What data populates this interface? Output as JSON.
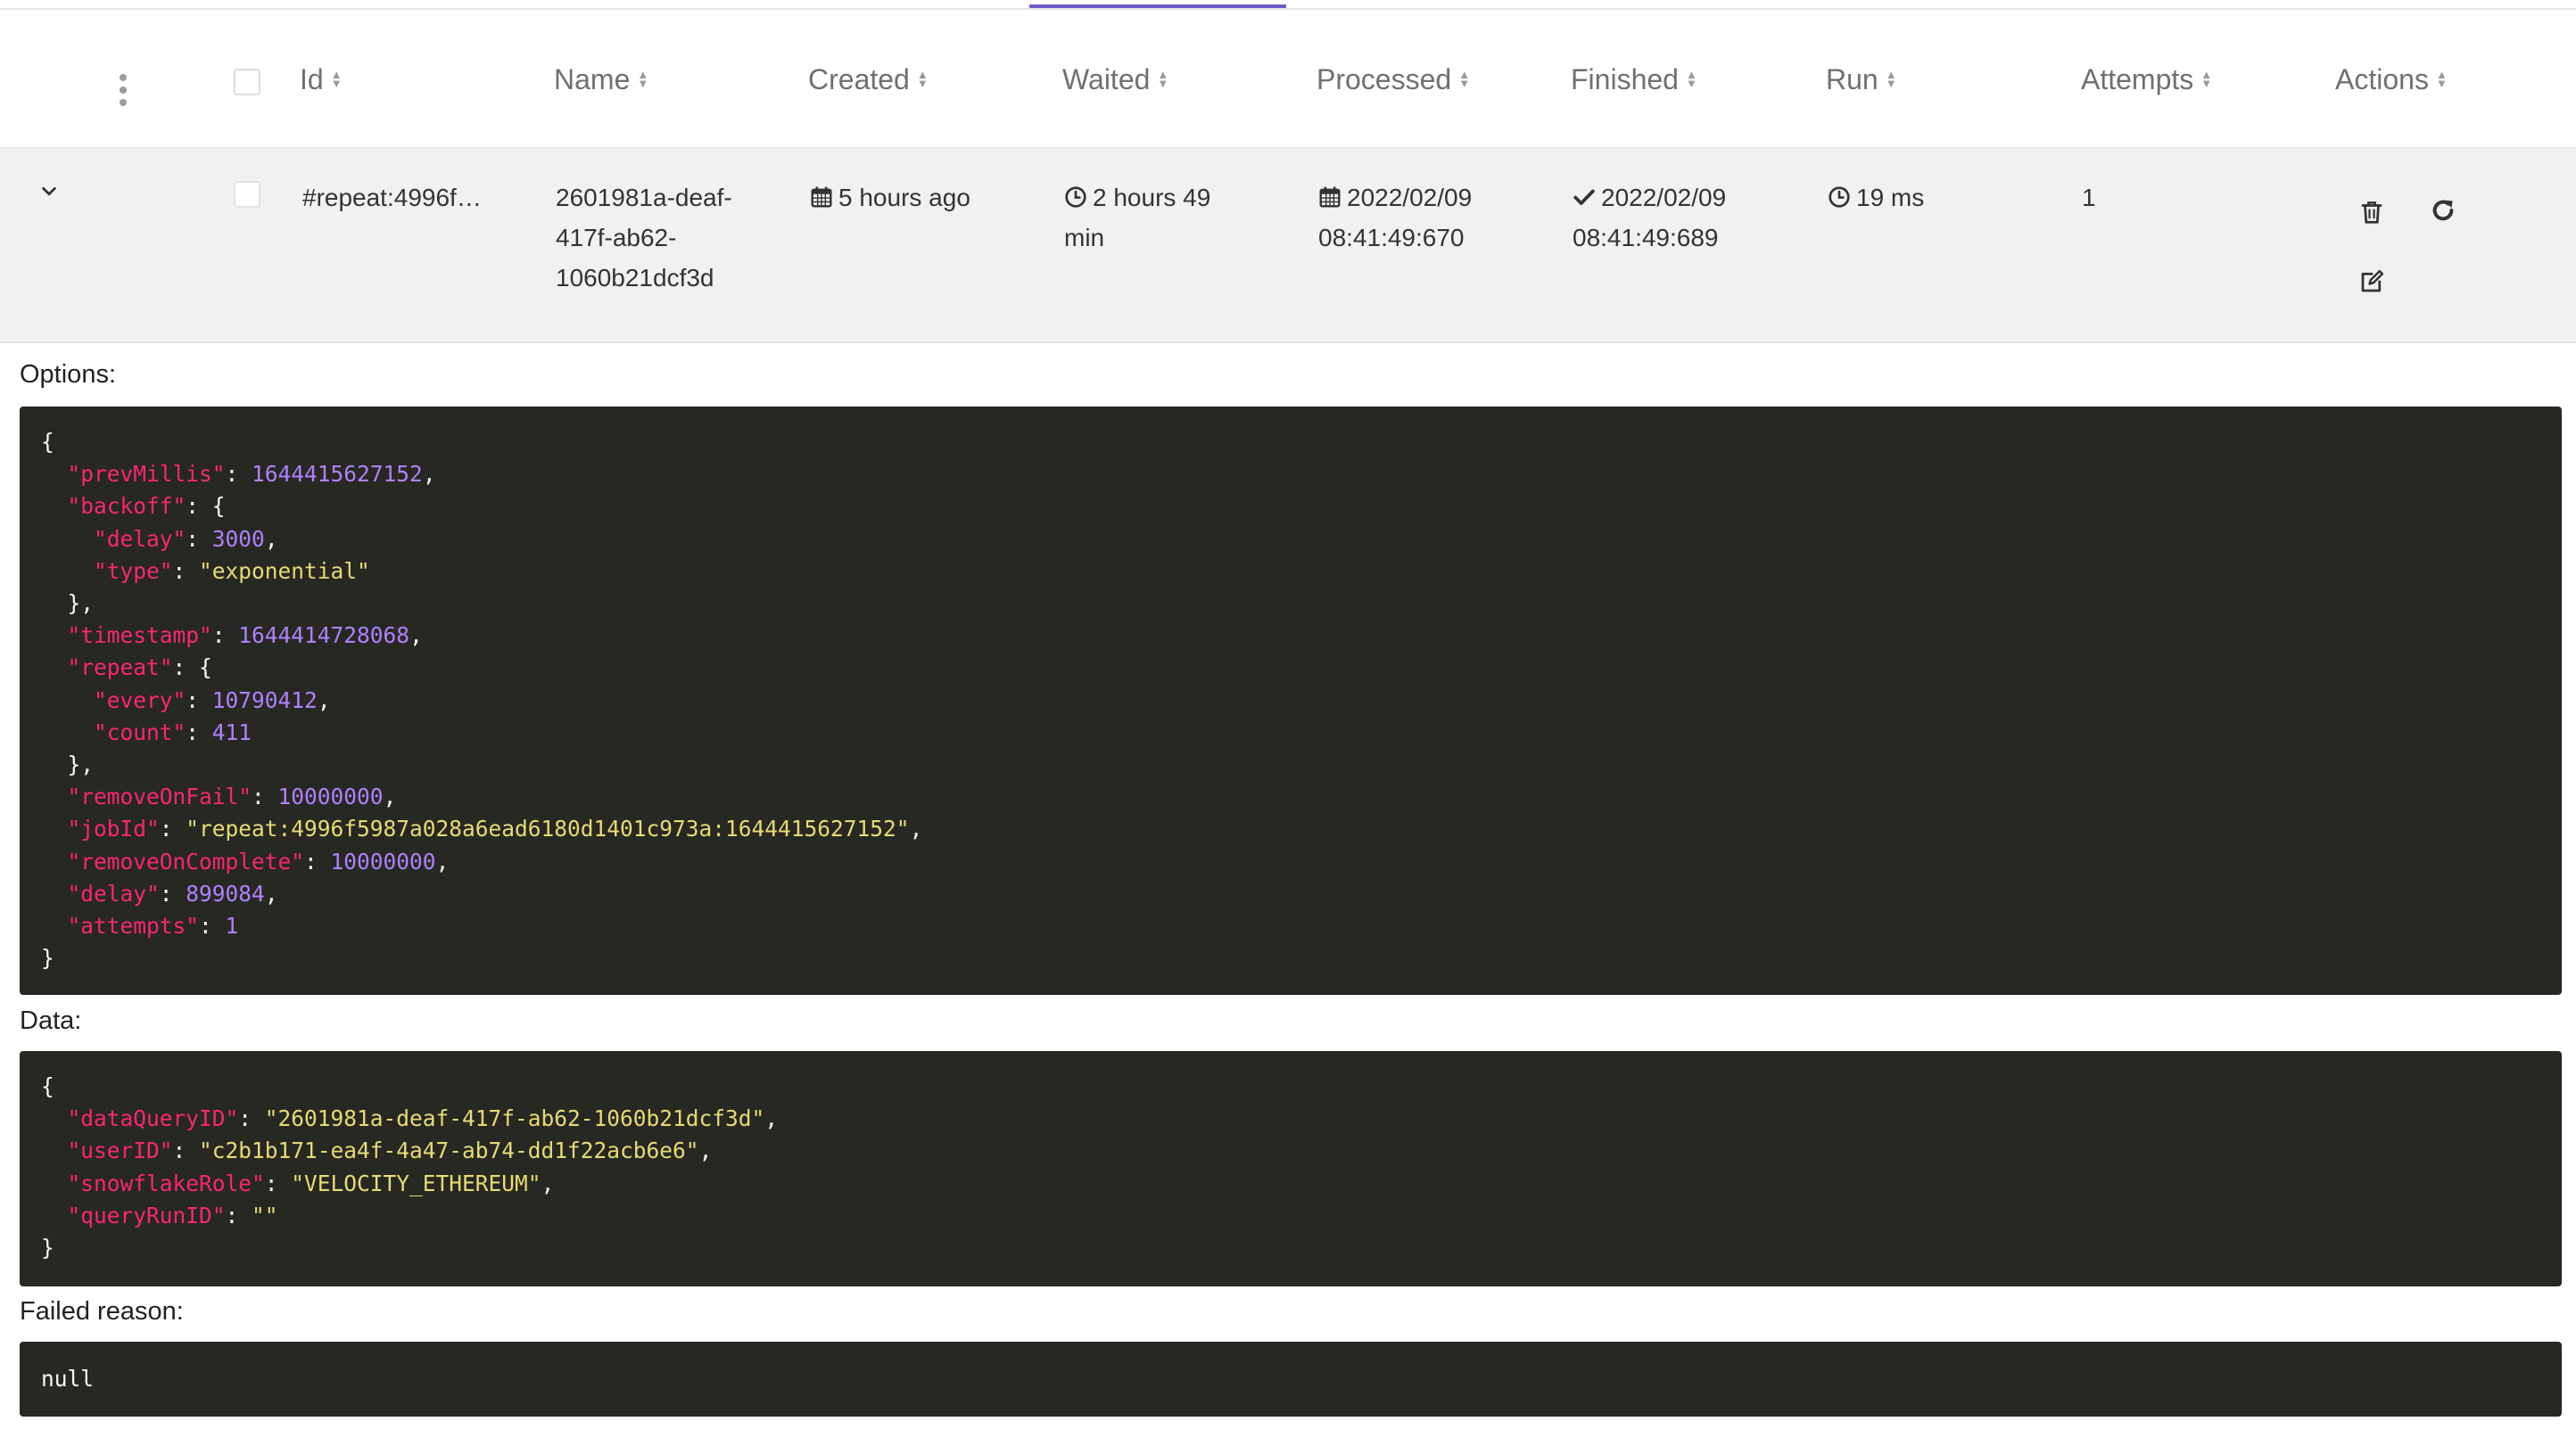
{
  "table": {
    "columns": [
      "Id",
      "Name",
      "Created",
      "Waited",
      "Processed",
      "Finished",
      "Run",
      "Attempts",
      "Actions"
    ]
  },
  "job": {
    "id": "#repeat:4996f…",
    "name_lines": [
      "2601981a-deaf-",
      "417f-ab62-",
      "1060b21dcf3d"
    ],
    "created": "5 hours ago",
    "waited_lines": [
      "2 hours 49",
      "min"
    ],
    "processed_lines": [
      "2022/02/09",
      "08:41:49:670"
    ],
    "finished_lines": [
      "2022/02/09",
      "08:41:49:689"
    ],
    "run": "19 ms",
    "attempts": "1"
  },
  "icons": {
    "more": "vertical-dots-icon",
    "expand": "chevron-down-icon",
    "created": "calendar-icon",
    "waited": "clock-icon",
    "processed": "calendar-icon",
    "finished": "checkmark-icon",
    "run": "clock-icon",
    "delete": "trash-icon",
    "retry": "refresh-icon",
    "edit": "edit-icon"
  },
  "sections": {
    "options_label": "Options:",
    "data_label": "Data:",
    "failed_label": "Failed reason:"
  },
  "options": {
    "prevMillis": "1644415627152",
    "backoff": {
      "delay": "3000",
      "type": "\"exponential\""
    },
    "timestamp": "1644414728068",
    "repeat": {
      "every": "10790412",
      "count": "411"
    },
    "removeOnFail": "10000000",
    "jobId": "\"repeat:4996f5987a028a6ead6180d1401c973a:1644415627152\"",
    "removeOnComplete": "10000000",
    "delay": "899084",
    "attempts": "1"
  },
  "data": {
    "dataQueryID": "\"2601981a-deaf-417f-ab62-1060b21dcf3d\"",
    "userID": "\"c2b1b171-ea4f-4a47-ab74-dd1f22acb6e6\"",
    "snowflakeRole": "\"VELOCITY_ETHEREUM\"",
    "queryRunID": "\"\""
  },
  "failed_reason": "null",
  "colors": {
    "accent": "#6e59c7",
    "code_bg": "#272822",
    "code_key": "#f92672",
    "code_string": "#e6db74",
    "code_number": "#ae81ff"
  }
}
